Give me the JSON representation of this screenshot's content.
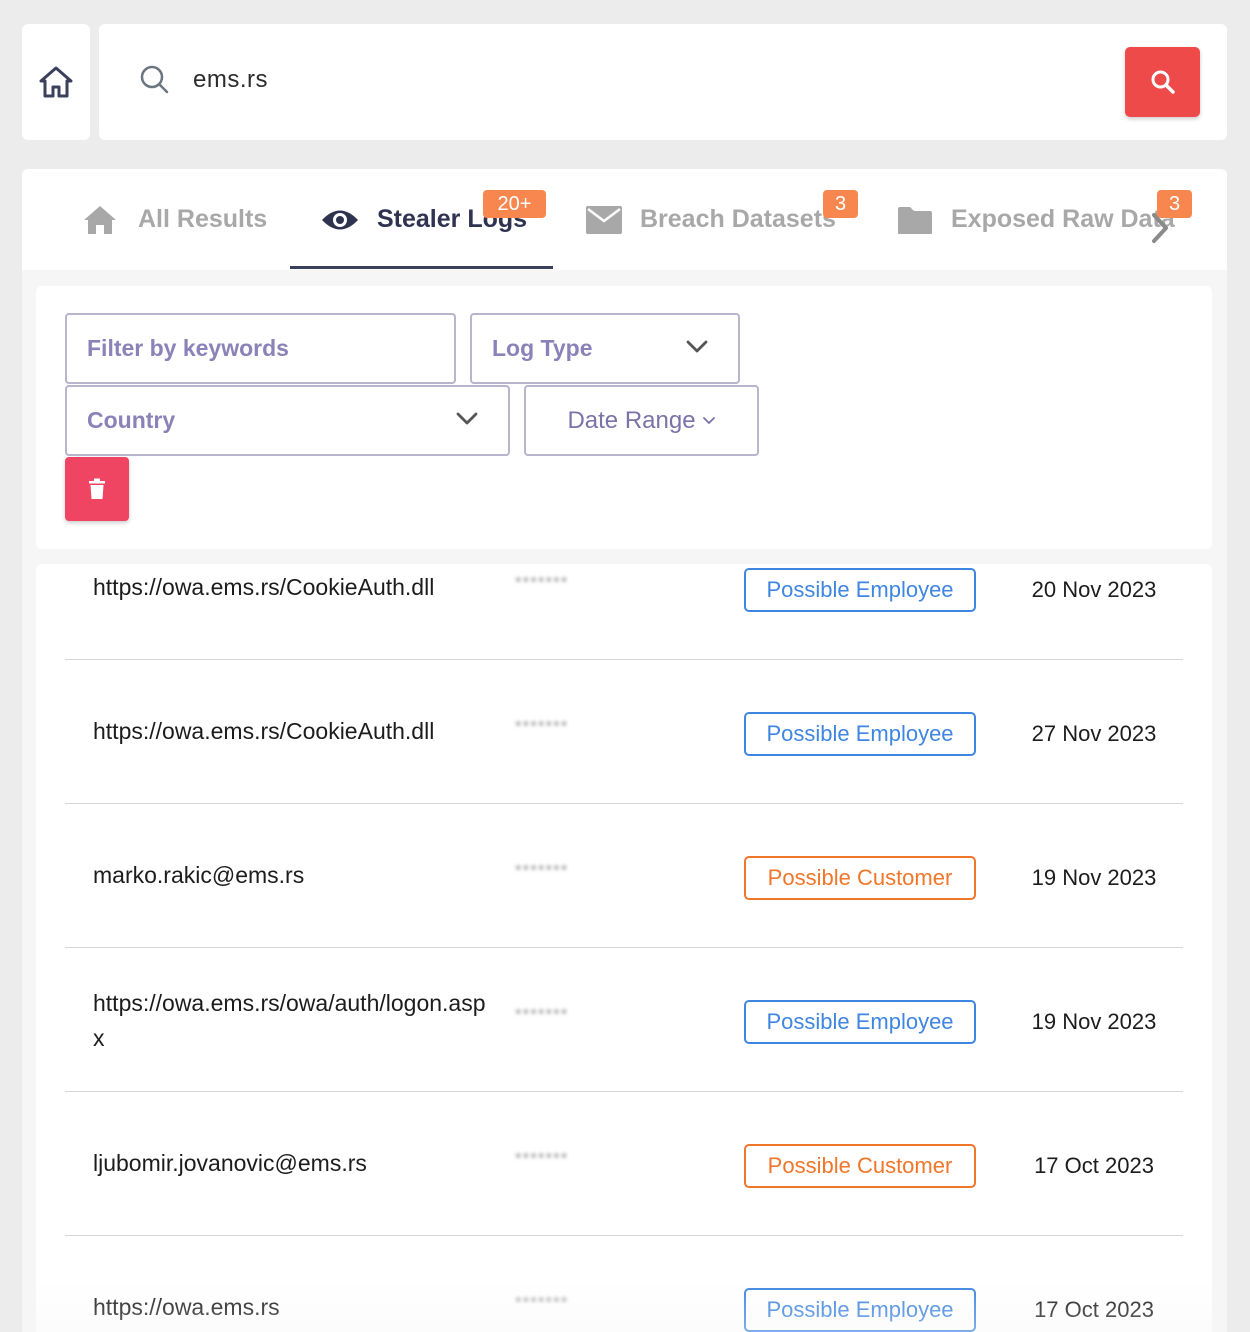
{
  "search": {
    "value": "ems.rs"
  },
  "tabs": [
    {
      "label": "All Results",
      "icon": "home-icon",
      "active": false
    },
    {
      "label": "Stealer Logs",
      "icon": "eye-icon",
      "active": true,
      "badge": "20+"
    },
    {
      "label": "Breach Datasets",
      "icon": "envelope-icon",
      "active": false,
      "badge": "3"
    },
    {
      "label": "Exposed Raw Data",
      "icon": "folder-icon",
      "active": false,
      "badge": "3"
    }
  ],
  "filters": {
    "keywords_placeholder": "Filter by keywords",
    "log_type": "Log Type",
    "country": "Country",
    "date_range": "Date Range"
  },
  "results": [
    {
      "url": "https://owa.ems.rs/CookieAuth.dll",
      "password": "*******",
      "tag": "Possible Employee",
      "date": "20 Nov 2023"
    },
    {
      "url": "https://owa.ems.rs/CookieAuth.dll",
      "password": "*******",
      "tag": "Possible Employee",
      "date": "27 Nov 2023"
    },
    {
      "url": "marko.rakic@ems.rs",
      "password": "*******",
      "tag": "Possible Customer",
      "date": "19 Nov 2023"
    },
    {
      "url": "https://owa.ems.rs/owa/auth/logon.aspx",
      "password": "*******",
      "tag": "Possible Employee",
      "date": "19 Nov 2023"
    },
    {
      "url": "ljubomir.jovanovic@ems.rs",
      "password": "*******",
      "tag": "Possible Customer",
      "date": "17 Oct 2023"
    },
    {
      "url": "https://owa.ems.rs",
      "password": "*******",
      "tag": "Possible Employee",
      "date": "17 Oct 2023"
    }
  ],
  "colors": {
    "search_button": "#ef4a4a",
    "trash_button": "#ef4562",
    "badge": "#f7874f",
    "employee_tag": "#3f86e0",
    "customer_tag": "#f0762a",
    "active_tab": "#2f3350"
  }
}
